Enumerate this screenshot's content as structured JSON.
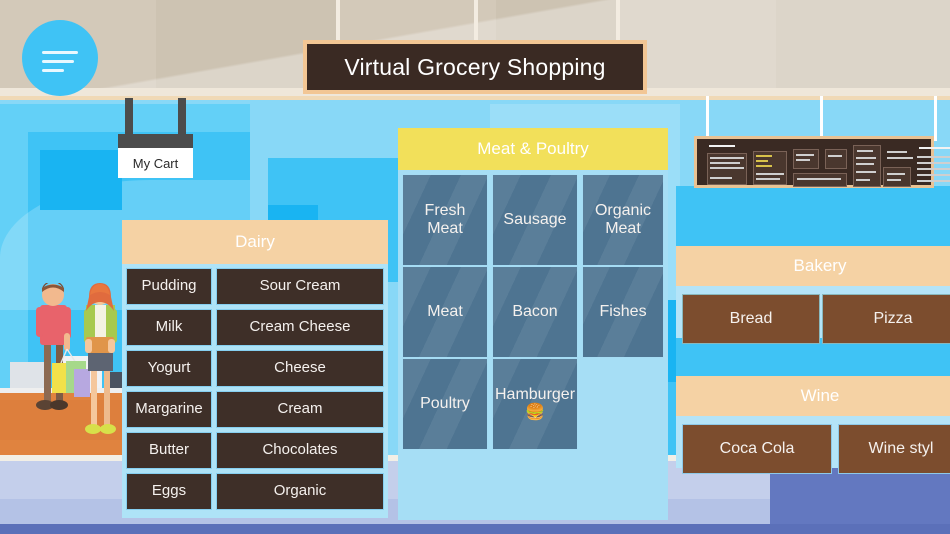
{
  "app": {
    "title": "Virtual Grocery Shopping",
    "menu_icon": "hamburger-menu-icon",
    "cart_label": "My Cart"
  },
  "scene": {
    "shoppers_alt": "two-shoppers-illustration",
    "menu_board_alt": "decorative-menu-board",
    "counter_alt": "checkout-counter"
  },
  "colors": {
    "accent_blue": "#3fc3f5",
    "wall_blue": "#88d8f7",
    "ceiling": "#cdc3b2",
    "floor": "#6378c0",
    "banner_bg": "#3a2a23",
    "banner_border": "#f2c694",
    "dairy_header": "#f5d2a4",
    "dairy_tile": "#3e2f28",
    "meat_header": "#f2e05a",
    "meat_tile": "#4e7491",
    "bakery_header": "#f5d2a4",
    "bakery_tile": "#7c4d2e",
    "wine_header": "#f5d2a4",
    "wine_tile": "#7c4d2e"
  },
  "sections": {
    "dairy": {
      "title": "Dairy",
      "rows": [
        {
          "left": "Pudding",
          "right": "Sour Cream"
        },
        {
          "left": "Milk",
          "right": "Cream Cheese"
        },
        {
          "left": "Yogurt",
          "right": "Cheese"
        },
        {
          "left": "Margarine",
          "right": "Cream"
        },
        {
          "left": "Butter",
          "right": "Chocolates"
        },
        {
          "left": "Eggs",
          "right": "Organic"
        }
      ]
    },
    "meat": {
      "title": "Meat & Poultry",
      "rows": [
        [
          "Fresh Meat",
          "Sausage",
          "Organic Meat"
        ],
        [
          "Meat",
          "Bacon",
          "Fishes"
        ],
        [
          "Poultry",
          "Hamburger 🍔",
          ""
        ]
      ]
    },
    "bakery": {
      "title": "Bakery",
      "items": [
        "Bread",
        "Pizza"
      ]
    },
    "wine": {
      "title": "Wine",
      "items": [
        "Coca Cola",
        "Wine styl"
      ]
    }
  }
}
